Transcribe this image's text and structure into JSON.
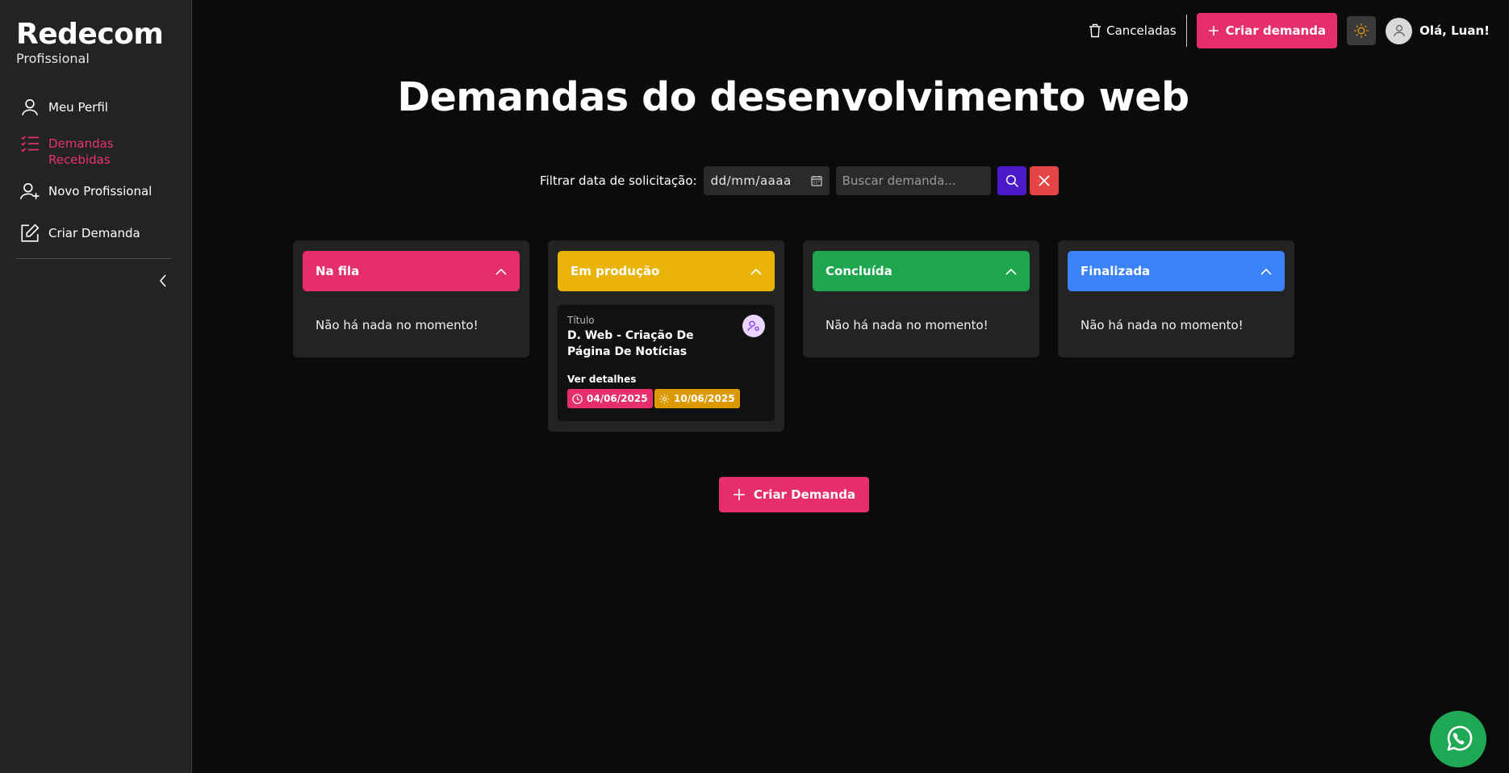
{
  "brand": {
    "title": "Redecom",
    "subtitle": "Profissional"
  },
  "sidebar": {
    "items": [
      {
        "label": "Meu Perfil",
        "icon": "user-icon",
        "active": false
      },
      {
        "label": "Demandas Recebidas",
        "icon": "checklist-icon",
        "active": true
      },
      {
        "label": "Novo Profissional",
        "icon": "user-plus-icon",
        "active": false
      },
      {
        "label": "Criar Demanda",
        "icon": "edit-icon",
        "active": false
      }
    ],
    "collapse_icon": "chevron-left-icon"
  },
  "topbar": {
    "canceled_label": "Canceladas",
    "create_label": "Criar demanda",
    "theme_icon": "sun-icon",
    "greeting": "Olá, Luan!"
  },
  "page": {
    "title": "Demandas do desenvolvimento web"
  },
  "filter": {
    "label": "Filtrar data de solicitação:",
    "date_placeholder": "dd/mm/aaaa",
    "search_placeholder": "Buscar demanda..."
  },
  "columns": [
    {
      "title": "Na fila",
      "color": "#e62d6e",
      "empty_text": "Não há nada no momento!"
    },
    {
      "title": "Em produção",
      "color": "#eab308",
      "empty_text": ""
    },
    {
      "title": "Concluída",
      "color": "#1ea64f",
      "empty_text": "Não há nada no momento!"
    },
    {
      "title": "Finalizada",
      "color": "#3b82f6",
      "empty_text": "Não há nada no momento!"
    }
  ],
  "card": {
    "kicker": "Título",
    "title": "D. Web - Criação De Página De Notícias",
    "link": "Ver detalhes",
    "start_date": "04/06/2025",
    "due_date": "10/06/2025"
  },
  "main_create_label": "Criar Demanda",
  "colors": {
    "accent": "#e62d6e",
    "sidebar_bg": "#232323",
    "page_bg": "#0b0b0b",
    "search_btn": "#4a19c9",
    "clear_btn": "#e44444",
    "whatsapp": "#1fa855"
  }
}
